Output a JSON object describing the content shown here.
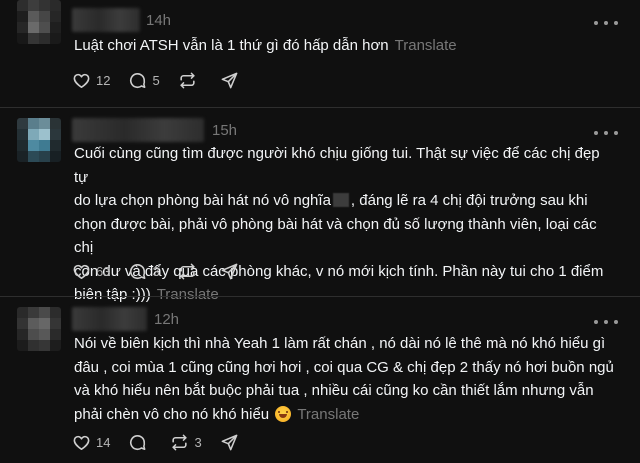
{
  "posts": [
    {
      "time": "14h",
      "text": "Luật chơi ATSH vẫn là 1 thứ gì đó hấp dẫn hơn",
      "translate": "Translate",
      "likes": "12",
      "replies": "5",
      "reposts": ""
    },
    {
      "time": "15h",
      "text_a": "Cuối cùng cũng tìm được người khó chịu giống tui. Thật sự việc để các chị đẹp tự\ndo lựa chọn phòng bài hát nó vô nghĩa",
      "text_b": ", đáng lẽ ra 4 chị đội trưởng sau khi\nchọn được bài, phải vô phòng bài hát và chọn đủ số lượng thành viên, loại các chị\ncòn dư và đẩy qua các phòng khác, v nó mới kịch tính. Phần này tui cho 1 điểm\nbiên tập :)))",
      "translate": "Translate",
      "likes": "63",
      "replies": "3",
      "reposts": ""
    },
    {
      "time": "12h",
      "text": "Nói về biên kịch thì nhà Yeah 1 làm rất chán , nó dài nó lê thê mà nó khó hiểu gì\nđâu , coi mùa 1 cũng cũng hơi hơi , coi qua CG & chị đẹp 2 thấy nó hơi buồn ngủ\nvà khó hiểu nên bắt buộc phải tua , nhiều cái cũng ko cần thiết lắm nhưng vẫn\nphải chèn vô cho nó khó hiểu",
      "translate": "Translate",
      "likes": "14",
      "replies": "",
      "reposts": "3"
    }
  ],
  "icons": {
    "like": "heart-icon",
    "reply": "comment-icon",
    "repost": "repost-icon",
    "share": "share-icon",
    "more": "more-icon"
  },
  "colors": {
    "background": "#101010",
    "text": "#f3f5f7",
    "muted": "#777777",
    "divider": "#2e2e2e"
  }
}
